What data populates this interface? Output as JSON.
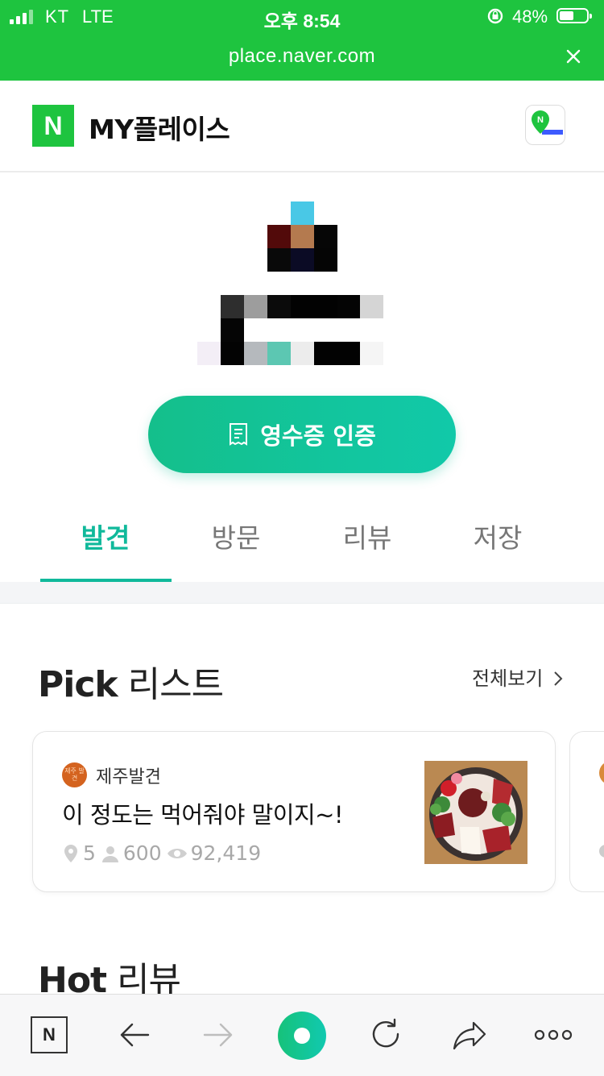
{
  "status_bar": {
    "carrier": "KT",
    "network": "LTE",
    "time": "오후 8:54",
    "battery": "48%"
  },
  "browser": {
    "url": "place.naver.com"
  },
  "header": {
    "logo": "N",
    "title": "MY플레이스"
  },
  "profile": {
    "receipt_button": "영수증 인증"
  },
  "tabs": [
    {
      "label": "발견",
      "active": true
    },
    {
      "label": "방문",
      "active": false
    },
    {
      "label": "리뷰",
      "active": false
    },
    {
      "label": "저장",
      "active": false
    }
  ],
  "pick_section": {
    "title_bold": "Pick",
    "title_rest": " 리스트",
    "see_all": "전체보기",
    "card": {
      "badge_text": "제주 발견",
      "author": "제주발견",
      "title": "이 정도는 먹어줘야 말이지~!",
      "places": "5",
      "followers": "600",
      "views": "92,419"
    }
  },
  "hot_section": {
    "title_bold": "Hot",
    "title_rest": " 리뷰"
  },
  "toolbar": {
    "home_logo": "N"
  },
  "colors": {
    "naver_green": "#1ec43f",
    "accent": "#10b99b"
  },
  "icons": [
    "lock-rotation-icon",
    "close-icon",
    "map-pin-icon",
    "receipt-icon",
    "chevron-right-icon",
    "location-icon",
    "person-icon",
    "eye-icon",
    "back-arrow-icon",
    "forward-arrow-icon",
    "refresh-icon",
    "share-icon",
    "more-icon"
  ]
}
